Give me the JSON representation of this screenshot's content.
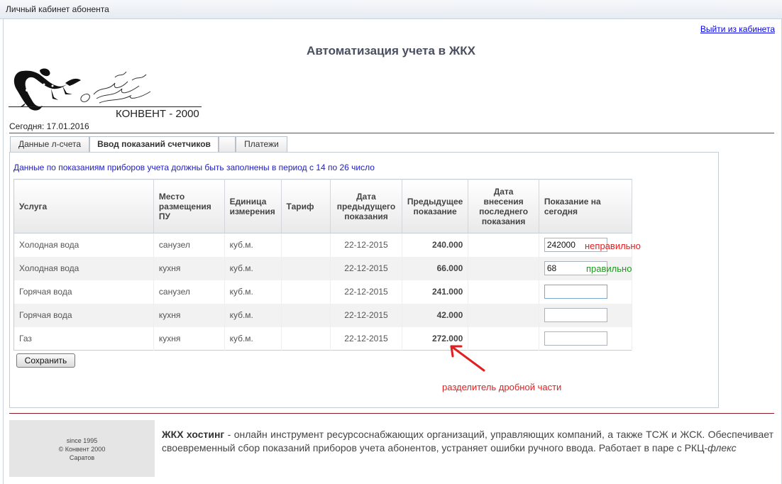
{
  "window": {
    "title": "Личный кабинет абонента"
  },
  "header": {
    "logout_link": "Выйти из кабинета",
    "app_title": "Автоматизация учета в ЖКХ",
    "logo_text": "КОНВЕНТ - 2000",
    "today": "Сегодня: 17.01.2016"
  },
  "tabs": [
    {
      "label": "Данные л-счета",
      "active": false
    },
    {
      "label": "Ввод показаний счетчиков",
      "active": true
    },
    {
      "label": "",
      "active": false
    },
    {
      "label": "Платежи",
      "active": false
    }
  ],
  "notice": "Данные по показаниям приборов учета должны быть заполнены в период с 14 по 26 число",
  "table": {
    "columns": [
      "Услуга",
      "Место размещения ПУ",
      "Единица измерения",
      "Тариф",
      "Дата предыдущего показания",
      "Предыдущее показание",
      "Дата внесения последнего показания",
      "Показание на сегодня"
    ],
    "rows": [
      {
        "service": "Холодная вода",
        "place": "санузел",
        "unit": "куб.м.",
        "tariff": "",
        "prev_date": "22-12-2015",
        "prev_value": "240.000",
        "last_date": "",
        "today": "242000"
      },
      {
        "service": "Холодная вода",
        "place": "кухня",
        "unit": "куб.м.",
        "tariff": "",
        "prev_date": "22-12-2015",
        "prev_value": "66.000",
        "last_date": "",
        "today": "68"
      },
      {
        "service": "Горячая вода",
        "place": "санузел",
        "unit": "куб.м.",
        "tariff": "",
        "prev_date": "22-12-2015",
        "prev_value": "241.000",
        "last_date": "",
        "today": ""
      },
      {
        "service": "Горячая вода",
        "place": "кухня",
        "unit": "куб.м.",
        "tariff": "",
        "prev_date": "22-12-2015",
        "prev_value": "42.000",
        "last_date": "",
        "today": ""
      },
      {
        "service": "Газ",
        "place": "кухня",
        "unit": "куб.м.",
        "tariff": "",
        "prev_date": "22-12-2015",
        "prev_value": "272.000",
        "last_date": "",
        "today": ""
      }
    ]
  },
  "save_button": "Сохранить",
  "annotations": {
    "wrong": "неправильно",
    "right": "правильно",
    "separator": "разделитель дробной части"
  },
  "colors": {
    "annotation_red": "#e02020",
    "annotation_green": "#1a9a1a",
    "notice_blue": "#2020c0"
  },
  "footer": {
    "since": "since 1995",
    "copyright": "© Конвент 2000",
    "city": "Саратов",
    "brand": "ЖКХ хостинг",
    "description": " - онлайн инструмент ресурсоснабжающих организаций, управляющих компаний, а также ТСЖ и ЖСК. Обеспечивает своевременный сбор показаний приборов учета абонентов, устраняет ошибки ручного ввода. Работает в паре с РКЦ-",
    "flex": "флекс"
  }
}
